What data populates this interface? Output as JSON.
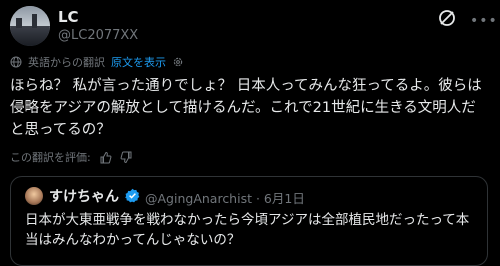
{
  "author": {
    "display_name": "LC",
    "handle": "@LC2077XX"
  },
  "translation": {
    "translated_from": "英語からの翻訳",
    "show_original": "原文を表示",
    "rate_prompt": "この翻訳を評価:"
  },
  "tweet": {
    "text": "ほらね？ 私が言った通りでしょ？ 日本人ってみんな狂ってるよ。彼らは侵略をアジアの解放として描けるんだ。これで21世紀に生きる文明人だと思ってるの？"
  },
  "quote": {
    "display_name": "すけちゃん",
    "handle_date": "@AgingAnarchist · 6月1日",
    "text": "日本が大東亜戦争を戦わなかったら今頃アジアは全部植民地だったって本当はみんなわかってんじゃないの？"
  },
  "icons": {
    "grok": "grok-icon",
    "more": "more-icon",
    "globe": "globe-icon",
    "gear": "gear-icon",
    "thumb_up": "thumb-up-icon",
    "thumb_down": "thumb-down-icon",
    "verified": "verified-badge-icon"
  },
  "colors": {
    "background": "#000000",
    "text": "#e7e9ea",
    "muted": "#71767b",
    "link": "#1d9bf0"
  }
}
